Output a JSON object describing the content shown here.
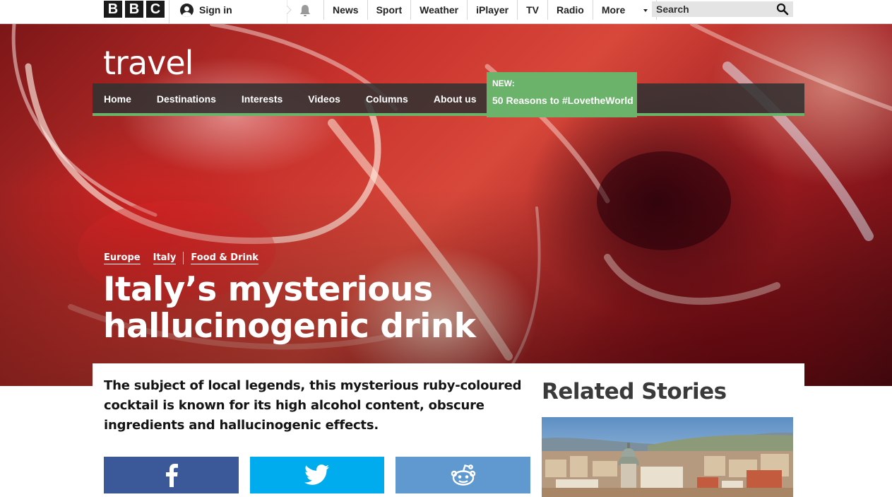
{
  "bbc": {
    "logo_letters": [
      "B",
      "B",
      "C"
    ],
    "sign_in": "Sign in",
    "nav": [
      "News",
      "Sport",
      "Weather",
      "iPlayer",
      "TV",
      "Radio",
      "More"
    ],
    "search_placeholder": "Search"
  },
  "travel": {
    "logo": "travel",
    "nav": [
      "Home",
      "Destinations",
      "Interests",
      "Videos",
      "Columns",
      "About us"
    ],
    "promo": {
      "label": "NEW:",
      "text": "50 Reasons to #LovetheWorld"
    }
  },
  "article": {
    "tags": [
      "Europe",
      "Italy",
      "Food & Drink"
    ],
    "headline_line1": "Italy’s mysterious",
    "headline_line2": "hallucinogenic drink",
    "summary": "The subject of local legends, this mysterious ruby-coloured cocktail is known for its high alcohol content, obscure ingredients and hallucinogenic effects."
  },
  "share": {
    "icons": [
      "facebook-icon",
      "twitter-icon",
      "reddit-icon"
    ]
  },
  "related": {
    "title": "Related Stories"
  },
  "colors": {
    "travel_green": "#6bb26a",
    "facebook": "#3b5998",
    "twitter": "#00aced",
    "reddit": "#5f99cf",
    "nav_dark": "#323232"
  }
}
